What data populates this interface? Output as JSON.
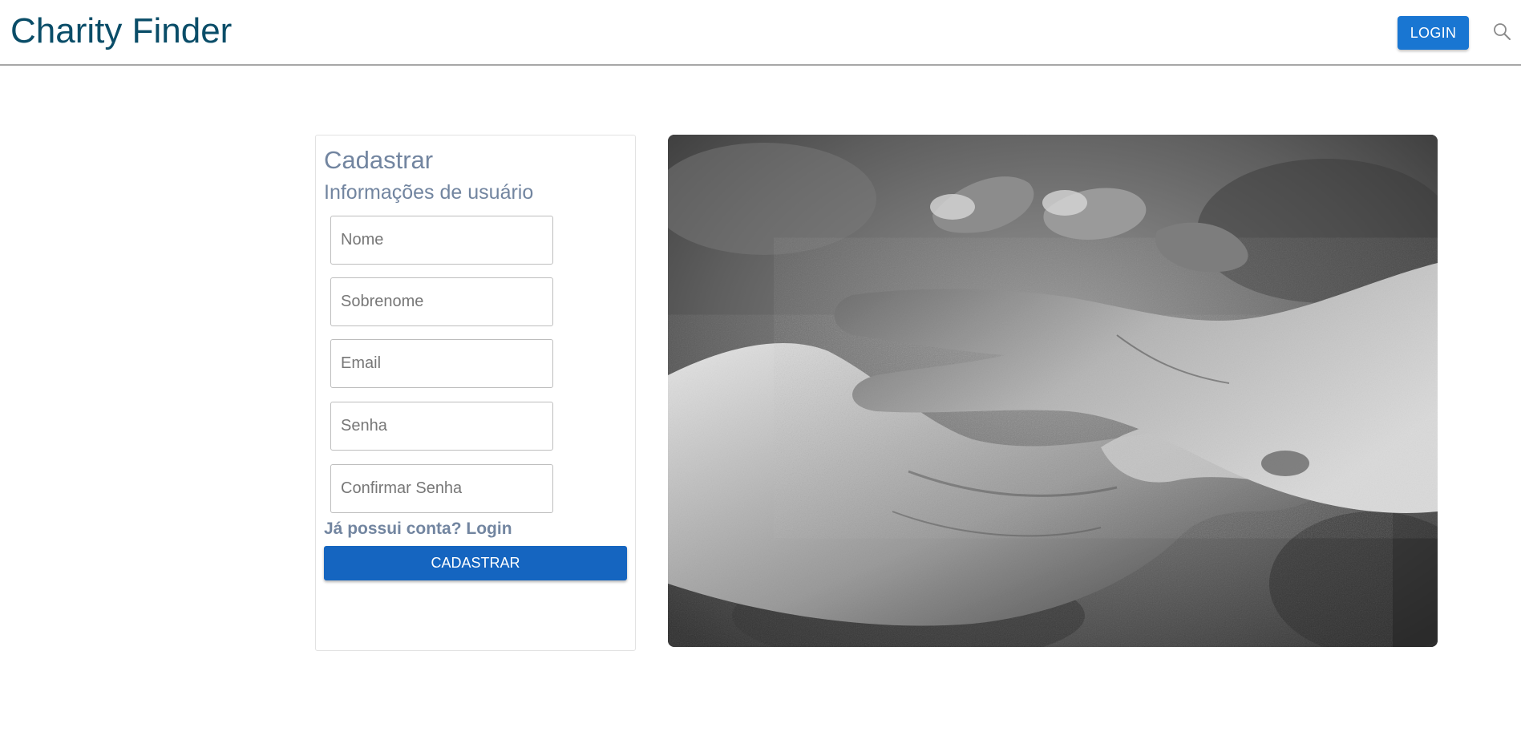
{
  "header": {
    "brand": "Charity Finder",
    "login_label": "LOGIN",
    "search_icon": "search-icon"
  },
  "form": {
    "title": "Cadastrar",
    "subtitle": "Informações de usuário",
    "fields": [
      {
        "placeholder": "Nome",
        "value": ""
      },
      {
        "placeholder": "Sobrenome",
        "value": ""
      },
      {
        "placeholder": "Email",
        "value": ""
      },
      {
        "placeholder": "Senha",
        "value": ""
      },
      {
        "placeholder": "Confirmar Senha",
        "value": ""
      }
    ],
    "login_link": "Já possui conta? Login",
    "submit_label": "CADASTRAR"
  },
  "colors": {
    "brand": "#0a4d68",
    "primary": "#1976d2",
    "muted_text": "#7285a0"
  },
  "image": {
    "subject": "helping-hands-photo"
  }
}
